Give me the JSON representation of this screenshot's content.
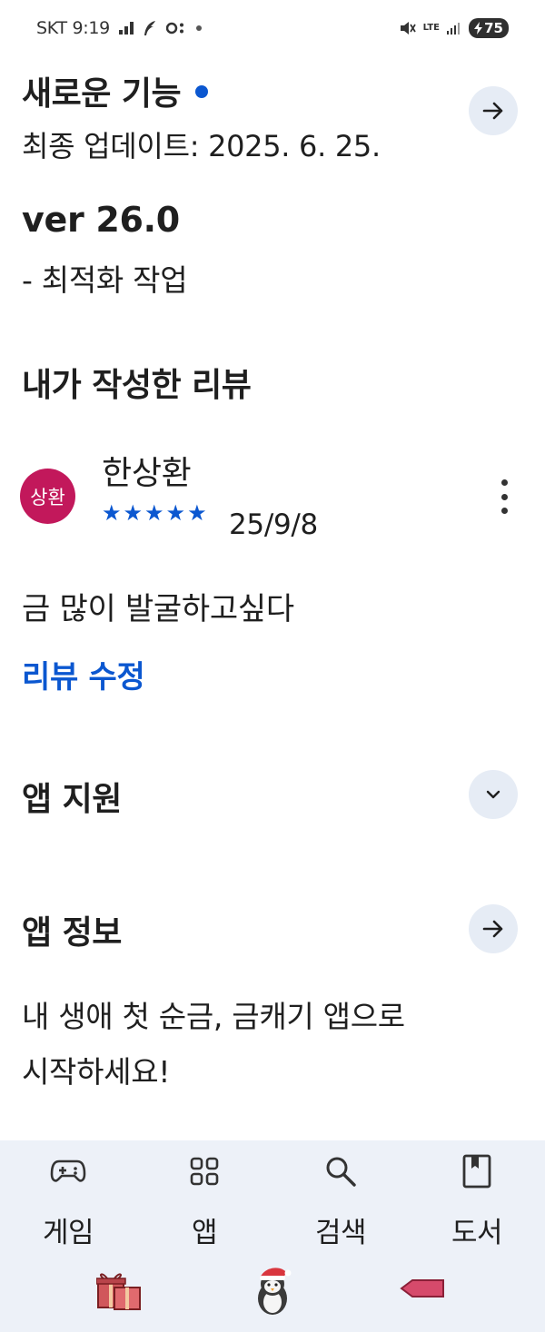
{
  "status_bar": {
    "carrier_time": "SKT 9:19",
    "network": "LTE",
    "battery": "75"
  },
  "whats_new": {
    "title": "새로운 기능",
    "updated": "최종 업데이트: 2025. 6. 25.",
    "version": "ver 26.0",
    "notes": "- 최적화 작업"
  },
  "my_review": {
    "section_title": "내가 작성한 리뷰",
    "avatar_text": "상환",
    "reviewer_name": "한상환",
    "rating": 5,
    "stars": "★★★★★",
    "date": "25/9/8",
    "body": "금 많이 발굴하고싶다",
    "edit_label": "리뷰 수정"
  },
  "app_support": {
    "title": "앱 지원"
  },
  "app_info": {
    "title": "앱 정보",
    "line1": "내 생애 첫 순금, 금캐기 앱으로",
    "line2": "시작하세요!"
  },
  "bottom_nav": {
    "items": [
      {
        "label": "게임",
        "icon": "gamepad-icon"
      },
      {
        "label": "앱",
        "icon": "apps-grid-icon"
      },
      {
        "label": "검색",
        "icon": "search-icon"
      },
      {
        "label": "도서",
        "icon": "book-icon"
      }
    ]
  },
  "colors": {
    "accent_blue": "#0b57d0",
    "button_bg": "#e6ecf5",
    "avatar_bg": "#c2185b",
    "nav_bg": "#edf1f8"
  }
}
